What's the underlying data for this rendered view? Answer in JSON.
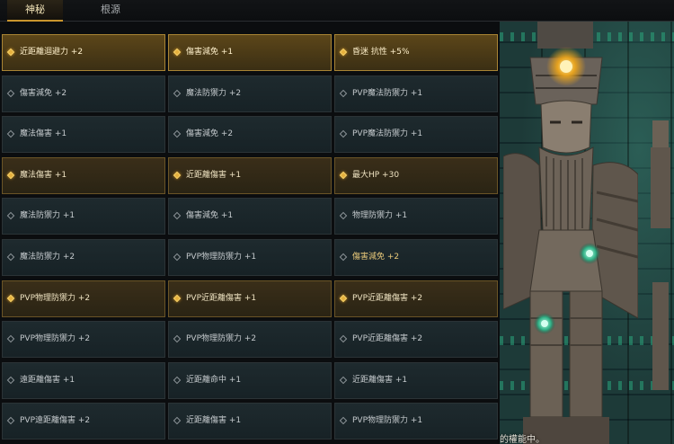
{
  "tabs": [
    {
      "label": "神秘",
      "active": true
    },
    {
      "label": "根源",
      "active": false
    }
  ],
  "footer_text": "的權能中。",
  "columns": [
    [
      {
        "label": "近距離迴避力 +2",
        "highlight": true,
        "bright": true
      },
      {
        "label": "傷害減免 +2",
        "highlight": false
      },
      {
        "label": "魔法傷害 +1",
        "highlight": false
      },
      {
        "label": "魔法傷害 +1",
        "highlight": true
      },
      {
        "label": "魔法防禦力 +1",
        "highlight": false
      },
      {
        "label": "魔法防禦力 +2",
        "highlight": false
      },
      {
        "label": "PVP物理防禦力 +2",
        "highlight": true
      },
      {
        "label": "PVP物理防禦力 +2",
        "highlight": false
      },
      {
        "label": "遠距離傷害 +1",
        "highlight": false
      },
      {
        "label": "PVP遠距離傷害 +2",
        "highlight": false
      }
    ],
    [
      {
        "label": "傷害減免 +1",
        "highlight": true,
        "bright": true
      },
      {
        "label": "魔法防禦力 +2",
        "highlight": false
      },
      {
        "label": "傷害減免 +2",
        "highlight": false
      },
      {
        "label": "近距離傷害 +1",
        "highlight": true
      },
      {
        "label": "傷害減免 +1",
        "highlight": false
      },
      {
        "label": "PVP物理防禦力 +1",
        "highlight": false
      },
      {
        "label": "PVP近距離傷害 +1",
        "highlight": true
      },
      {
        "label": "PVP物理防禦力 +2",
        "highlight": false
      },
      {
        "label": "近距離命中 +1",
        "highlight": false
      },
      {
        "label": "近距離傷害 +1",
        "highlight": false
      }
    ],
    [
      {
        "label": "昏迷 抗性 +5%",
        "highlight": true,
        "bright": true
      },
      {
        "label": "PVP魔法防禦力 +1",
        "highlight": false
      },
      {
        "label": "PVP魔法防禦力 +1",
        "highlight": false
      },
      {
        "label": "最大HP +30",
        "highlight": true
      },
      {
        "label": "物理防禦力 +1",
        "highlight": false
      },
      {
        "label": "傷害減免 +2",
        "highlight": false,
        "gold": true
      },
      {
        "label": "PVP近距離傷害 +2",
        "highlight": true
      },
      {
        "label": "PVP近距離傷害 +2",
        "highlight": false
      },
      {
        "label": "近距離傷害 +1",
        "highlight": false
      },
      {
        "label": "PVP物理防禦力 +1",
        "highlight": false
      }
    ]
  ],
  "colors": {
    "accent_gold": "#c9962e",
    "cell_bg": "#1e2a2e",
    "highlight_bg": "#3a2e19"
  }
}
